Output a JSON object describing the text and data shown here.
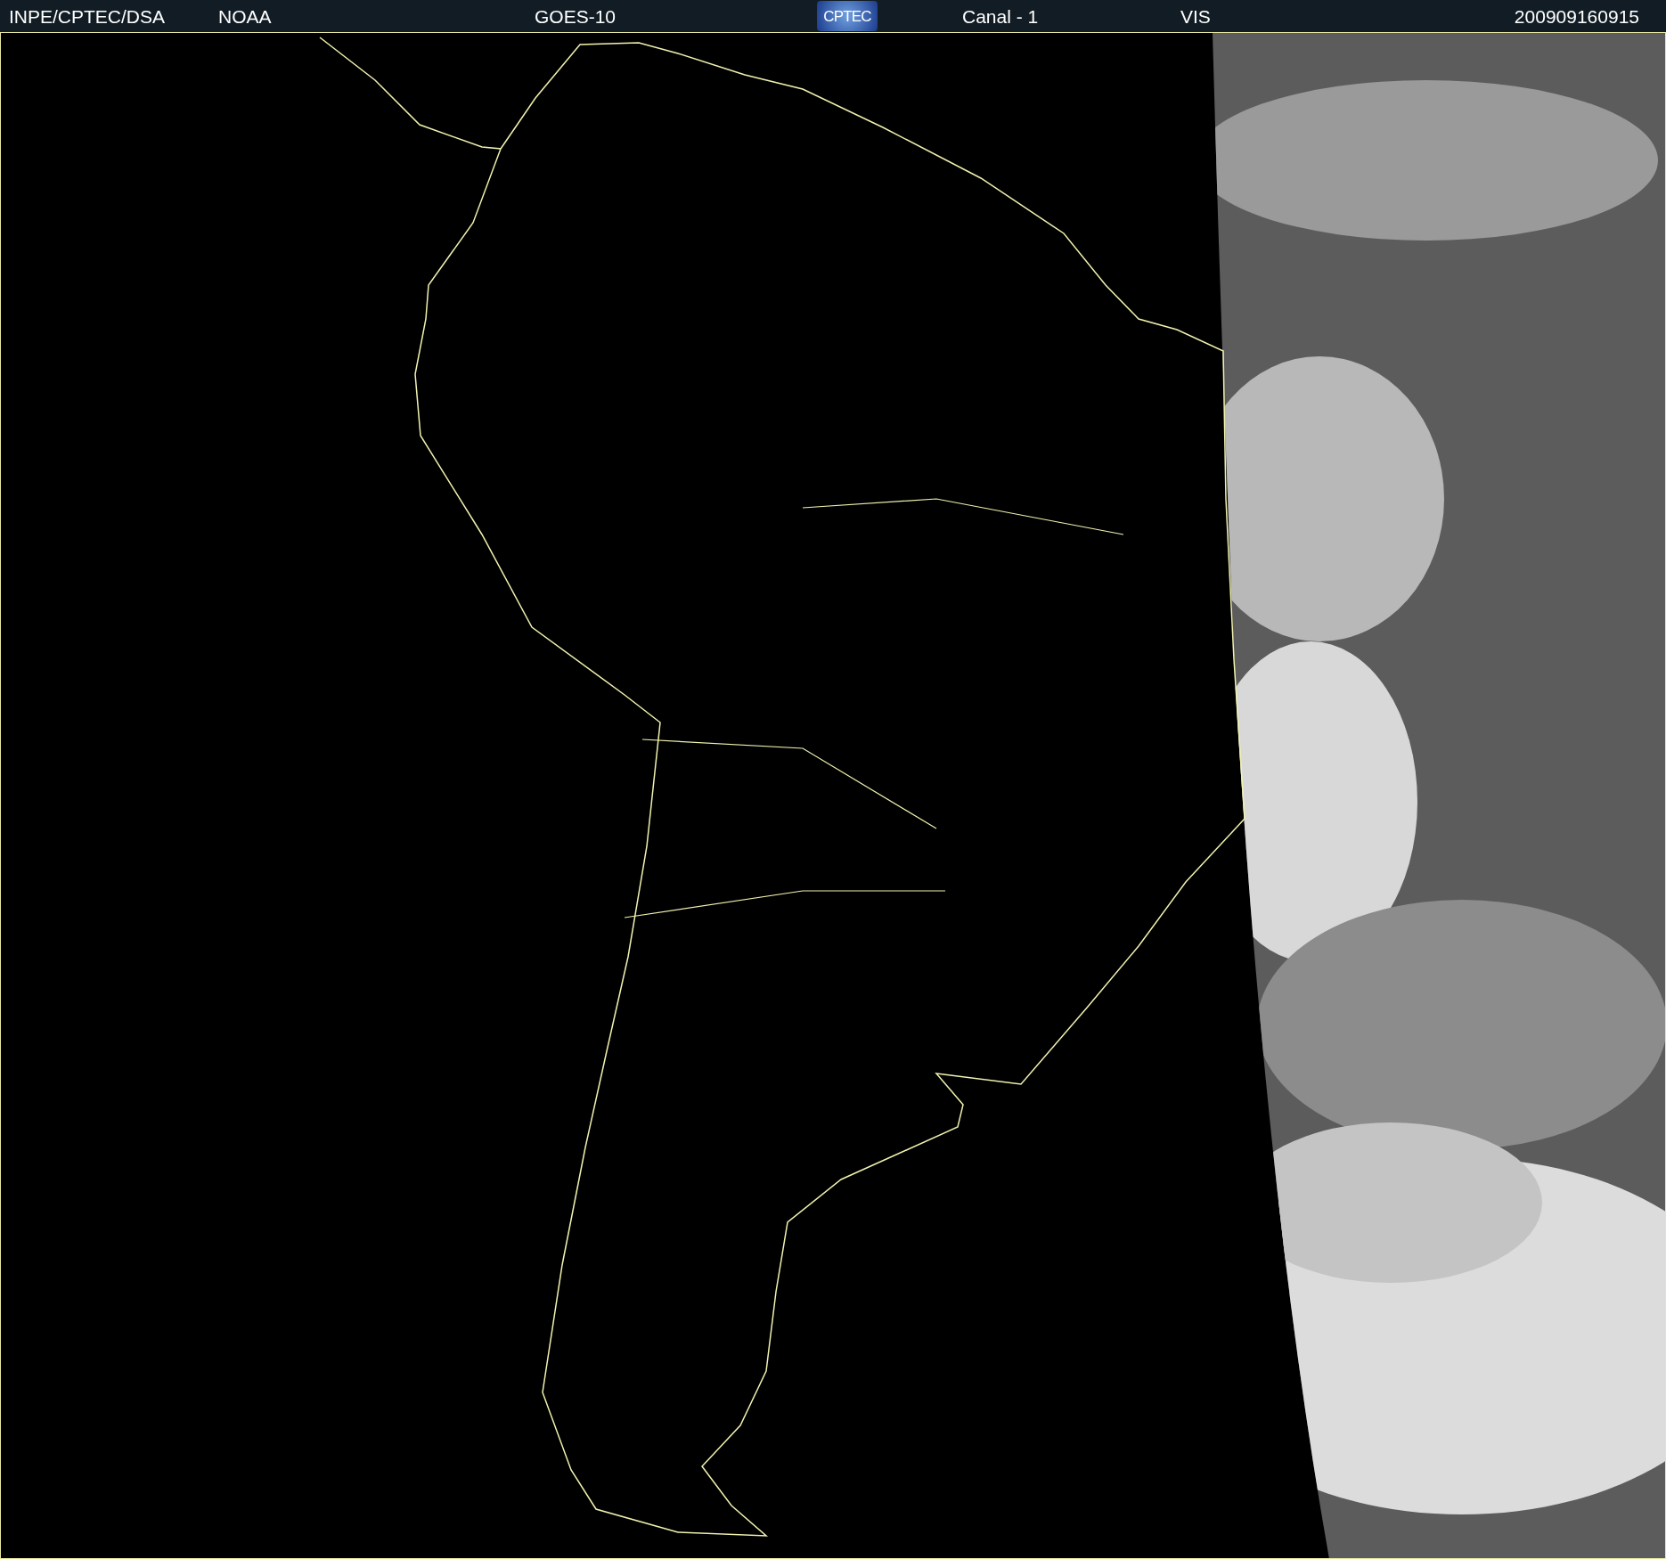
{
  "header": {
    "source": "INPE/CPTEC/DSA",
    "agency": "NOAA",
    "satellite": "GOES-10",
    "logo": "CPTEC",
    "channel": "Canal - 1",
    "band": "VIS",
    "timestamp": "200909160915"
  }
}
